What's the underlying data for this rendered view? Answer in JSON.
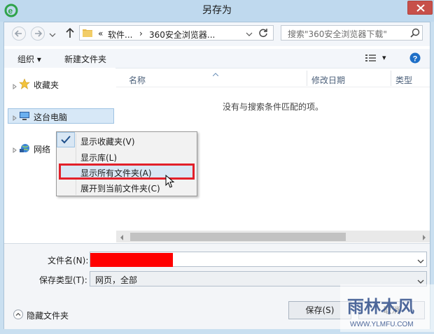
{
  "window": {
    "title": "另存为"
  },
  "address": {
    "path_prefix": "«",
    "crumb1": "软件...",
    "separator": "›",
    "crumb2": "360安全浏览器..."
  },
  "search": {
    "placeholder": "搜索\"360安全浏览器下载\""
  },
  "toolbar": {
    "organize": "组织 ▾",
    "new_folder": "新建文件夹",
    "view_dropdown": "▾"
  },
  "nav": {
    "favorites": "收藏夹",
    "this_pc": "这台电脑",
    "network": "网络"
  },
  "columns": {
    "name": "名称",
    "date": "修改日期",
    "type": "类型"
  },
  "empty_message": "没有与搜索条件匹配的项。",
  "context_menu": {
    "items": [
      {
        "label": "显示收藏夹(V)",
        "checked": true
      },
      {
        "label": "显示库(L)",
        "checked": false
      },
      {
        "label": "显示所有文件夹(A)",
        "checked": false
      },
      {
        "label": "展开到当前文件夹(C)",
        "checked": false
      }
    ]
  },
  "form": {
    "filename_label": "文件名(N):",
    "filename_value": "",
    "filetype_label": "保存类型(T):",
    "filetype_value": "网页，全部"
  },
  "footer": {
    "hide_folders": "隐藏文件夹",
    "save": "保存(S)",
    "cancel": "取消"
  },
  "watermark": {
    "text": "雨林木风",
    "url": "WWW.YLMFU.COM"
  },
  "colors": {
    "highlight_border": "#e2202a",
    "redaction": "#ff0000",
    "titlebar": "#bfd9ee",
    "close": "#c7504a"
  }
}
